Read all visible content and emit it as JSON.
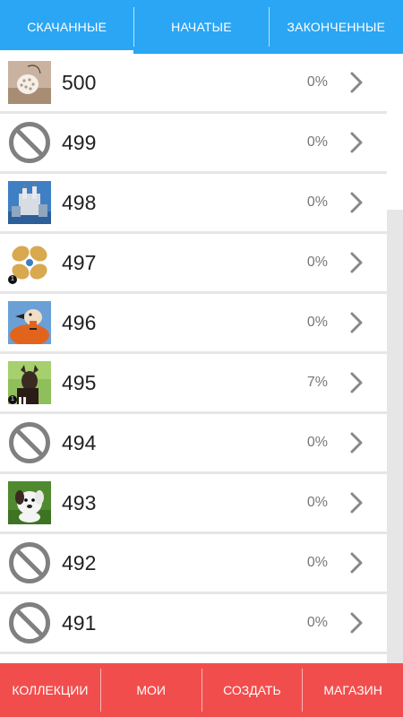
{
  "tabs": [
    {
      "label": "СКАЧАННЫЕ",
      "active": true
    },
    {
      "label": "НАЧАТЫЕ",
      "active": false
    },
    {
      "label": "ЗАКОНЧЕННЫЕ",
      "active": false
    }
  ],
  "items": [
    {
      "number": "500",
      "progress": "0%",
      "thumb": "lamp-photo"
    },
    {
      "number": "499",
      "progress": "0%",
      "thumb": "no-image-icon"
    },
    {
      "number": "498",
      "progress": "0%",
      "thumb": "castle-photo"
    },
    {
      "number": "497",
      "progress": "0%",
      "thumb": "cookies-photo",
      "badge": "1"
    },
    {
      "number": "496",
      "progress": "0%",
      "thumb": "duck-photo"
    },
    {
      "number": "495",
      "progress": "7%",
      "thumb": "okapi-photo",
      "badge": "1"
    },
    {
      "number": "494",
      "progress": "0%",
      "thumb": "no-image-icon"
    },
    {
      "number": "493",
      "progress": "0%",
      "thumb": "puppy-photo"
    },
    {
      "number": "492",
      "progress": "0%",
      "thumb": "no-image-icon"
    },
    {
      "number": "491",
      "progress": "0%",
      "thumb": "no-image-icon"
    }
  ],
  "bottom_nav": [
    {
      "label": "КОЛЛЕКЦИИ"
    },
    {
      "label": "МОИ"
    },
    {
      "label": "СОЗДАТЬ"
    },
    {
      "label": "МАГАЗИН"
    }
  ],
  "colors": {
    "tab_bar": "#2aa6f5",
    "bottom_bar": "#f24d4d",
    "background": "#e6e6e6"
  }
}
